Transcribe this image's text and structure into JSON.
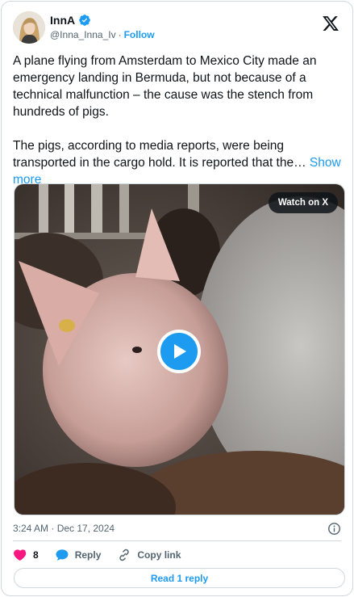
{
  "author": {
    "name": "InnA",
    "handle": "@Inna_Inna_Iv",
    "separator": "·",
    "follow_label": "Follow"
  },
  "tweet": {
    "paragraph1": "A plane flying from Amsterdam to Mexico City made an emergency landing in Bermuda, but not because of a technical malfunction – the cause was the stench from hundreds of pigs.",
    "paragraph2": "The pigs, according to media reports, were being transported in the cargo hold. It is reported that the…",
    "show_more_label": "Show more"
  },
  "media": {
    "watch_label": "Watch on X"
  },
  "meta": {
    "timestamp": "3:24 AM · Dec 17, 2024"
  },
  "actions": {
    "like_count": "8",
    "reply_label": "Reply",
    "copy_link_label": "Copy link"
  },
  "read_replies_label": "Read 1 reply",
  "colors": {
    "accent": "#1d9bf0",
    "like": "#f91880",
    "muted": "#536471",
    "border": "#cfd9de"
  },
  "icons": [
    "verified-badge-icon",
    "x-logo-icon",
    "play-icon",
    "info-icon",
    "heart-icon",
    "reply-bubble-icon",
    "link-icon"
  ]
}
